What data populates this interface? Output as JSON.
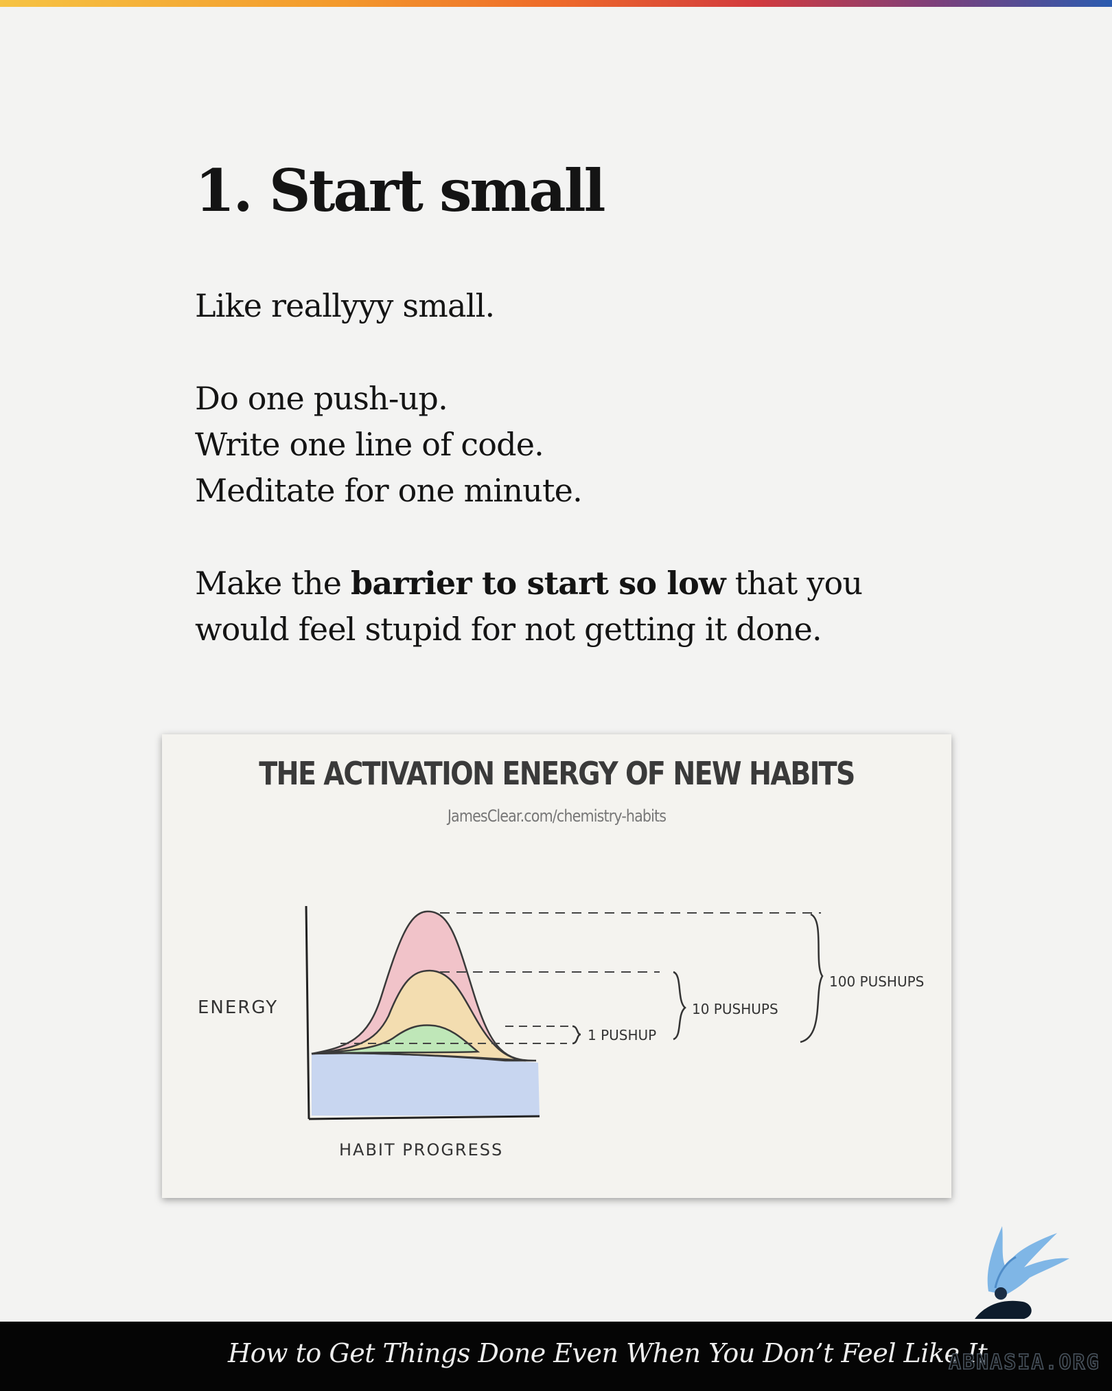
{
  "heading": "1. Start small",
  "paragraph1": "Like reallyyy small.",
  "examples": [
    "Do one push-up.",
    "Write one line of code.",
    "Meditate for one minute."
  ],
  "paragraph3": {
    "before": "Make the ",
    "bold": "barrier to start so low",
    "after": " that you would feel stupid for not getting it done."
  },
  "figure": {
    "title": "THE ACTIVATION ENERGY OF NEW HABITS",
    "subtitle": "JamesClear.com/chemistry-habits",
    "y_label": "ENERGY",
    "x_label": "HABIT PROGRESS",
    "annotations": [
      "1 PUSHUP",
      "10 PUSHUPS",
      "100 PUSHUPS"
    ],
    "colors": {
      "base": "#c8d6f0",
      "one": "#bfe7b8",
      "ten": "#f3ddb0",
      "hundred": "#f1c3c9"
    }
  },
  "footer": {
    "caption": "How to Get Things Done Even When You Don’t Feel Like It",
    "brand": "ABNASIA.ORG",
    "logo_icon": "griffin-logo-icon"
  }
}
